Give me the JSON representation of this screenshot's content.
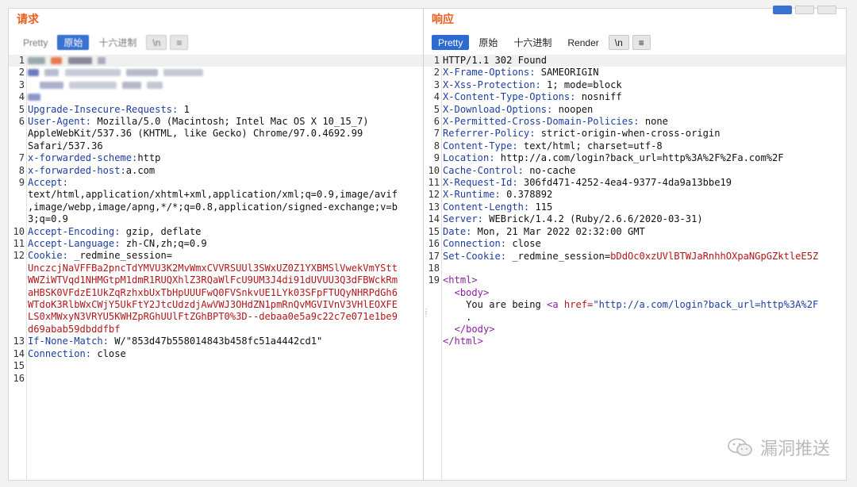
{
  "request": {
    "title": "请求",
    "toolbar": [
      "Pretty",
      "原始",
      "十六进制",
      "\\n",
      "≡"
    ],
    "active_tab": 1
  },
  "response": {
    "title": "响应",
    "toolbar": [
      "Pretty",
      "原始",
      "十六进制",
      "Render",
      "\\n",
      "≡"
    ],
    "active_tab": 0
  },
  "req_lines": {
    "l5k": "Upgrade-Insecure-Requests:",
    "l5v": " 1",
    "l6k": "User-Agent:",
    "l6v": " Mozilla/5.0 (Macintosh; Intel Mac OS X 10_15_7)",
    "l6b": "AppleWebKit/537.36 (KHTML, like Gecko) Chrome/97.0.4692.99",
    "l6c": "Safari/537.36",
    "l7k": "x-forwarded-scheme:",
    "l7v": "http",
    "l8k": "x-forwarded-host:",
    "l8v": "a.com",
    "l9k": "Accept:",
    "l9b": "text/html,application/xhtml+xml,application/xml;q=0.9,image/avif",
    "l9c": ",image/webp,image/apng,*/*;q=0.8,application/signed-exchange;v=b",
    "l9d": "3;q=0.9",
    "l10k": "Accept-Encoding:",
    "l10v": " gzip, deflate",
    "l11k": "Accept-Language:",
    "l11v": " zh-CN,zh;q=0.9",
    "l12k": "Cookie:",
    "l12v": " _redmine_session=",
    "l12a": "UnczcjNaVFFBa2pncTdYMVU3K2MvWmxCVVRSUUl3SWxUZ0Z1YXBMSlVwekVmYStt",
    "l12b": "WWZiWTVqd1NHMGtpM1dmR1RUQXhlZ3RQaWlFcU9UM3J4di91dUVUU3Q3dFBWckRm",
    "l12c": "aHBSK0VFdzE1UkZqRzhxbUxTbHpUUUFwQ0FVSnkvUE1LYk03SFpFTUQyNHRPdGh6",
    "l12d": "WTdoK3RlbWxCWjY5UkFtY2JtcUdzdjAwVWJ3OHdZN1pmRnQvMGVIVnV3VHlEOXFE",
    "l12e": "LS0xMWxyN3VRYU5KWHZpRGhUUlFtZGhBPT0%3D--debaa0e5a9c22c7e071e1be9",
    "l12f": "d69abab59dbddfbf",
    "l13k": "If-None-Match:",
    "l13v": " W/\"853d47b558014843b458fc51a4442cd1\"",
    "l14k": "Connection:",
    "l14v": " close"
  },
  "resp_lines": {
    "l1": "HTTP/1.1 302 Found",
    "l2k": "X-Frame-Options:",
    "l2v": " SAMEORIGIN",
    "l3k": "X-Xss-Protection:",
    "l3v": " 1; mode=block",
    "l4k": "X-Content-Type-Options:",
    "l4v": " nosniff",
    "l5k": "X-Download-Options:",
    "l5v": " noopen",
    "l6k": "X-Permitted-Cross-Domain-Policies:",
    "l6v": " none",
    "l7k": "Referrer-Policy:",
    "l7v": " strict-origin-when-cross-origin",
    "l8k": "Content-Type:",
    "l8v": " text/html; charset=utf-8",
    "l9k": "Location:",
    "l9v": " http://a.com/login?back_url=http%3A%2F%2Fa.com%2F",
    "l10k": "Cache-Control:",
    "l10v": " no-cache",
    "l11k": "X-Request-Id:",
    "l11v": " 306fd471-4252-4ea4-9377-4da9a13bbe19",
    "l12k": "X-Runtime:",
    "l12v": " 0.378892",
    "l13k": "Content-Length:",
    "l13v": " 115",
    "l14k": "Server:",
    "l14v": " WEBrick/1.4.2 (Ruby/2.6.6/2020-03-31)",
    "l15k": "Date:",
    "l15v": " Mon, 21 Mar 2022 02:32:00 GMT",
    "l16k": "Connection:",
    "l16v": " close",
    "l17k": "Set-Cookie:",
    "l17v": " _redmine_session=",
    "l17r": "bDdOc0xzUVlBTWJaRnhhOXpaNGpGZktleE5Z",
    "l19": "<html>",
    "l20": "<body>",
    "l21a": "You are being ",
    "l21t": "<a",
    "l21attr": " href=",
    "l21val": "\"http://a.com/login?back_url=http%3A%2F",
    "l22": ".",
    "l23": "</body>",
    "l24": "</html>"
  },
  "watermark": "漏洞推送"
}
